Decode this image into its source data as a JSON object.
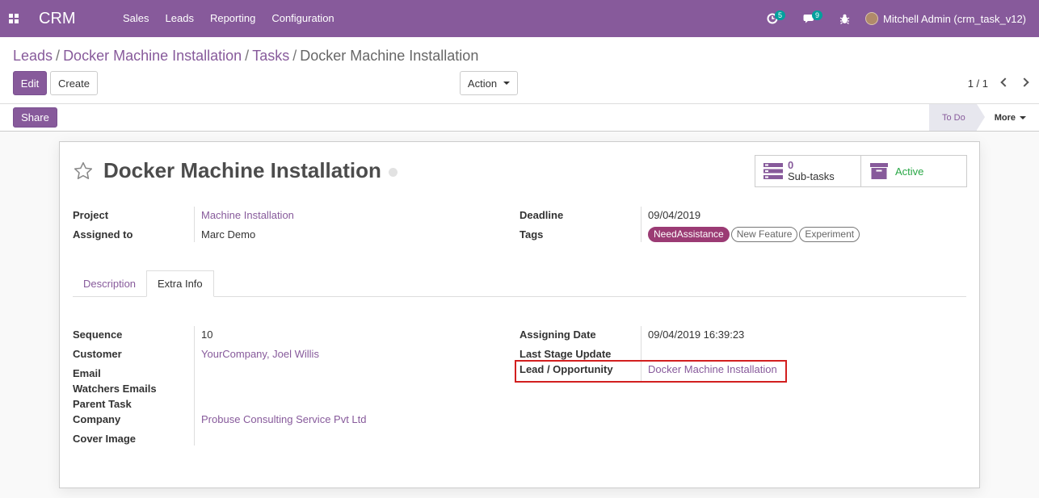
{
  "navbar": {
    "brand": "CRM",
    "menu": [
      "Sales",
      "Leads",
      "Reporting",
      "Configuration"
    ],
    "activity_count": "5",
    "messages_count": "9",
    "user": "Mitchell Admin (crm_task_v12)"
  },
  "breadcrumb": {
    "items": [
      "Leads",
      "Docker Machine Installation",
      "Tasks"
    ],
    "current": "Docker Machine Installation"
  },
  "buttons": {
    "edit": "Edit",
    "create": "Create",
    "action": "Action",
    "share": "Share"
  },
  "pager": "1 / 1",
  "statusbar": {
    "stage": "To Do",
    "more": "More"
  },
  "record": {
    "title": "Docker Machine Installation",
    "subtasks_count": "0",
    "subtasks_label": "Sub-tasks",
    "active_label": "Active"
  },
  "fields_top": {
    "project_label": "Project",
    "project_value": "Machine Installation",
    "assigned_label": "Assigned to",
    "assigned_value": "Marc Demo",
    "deadline_label": "Deadline",
    "deadline_value": "09/04/2019",
    "tags_label": "Tags",
    "tags": [
      "NeedAssistance",
      "New Feature",
      "Experiment"
    ]
  },
  "tabs": [
    "Description",
    "Extra Info"
  ],
  "extra_info": {
    "sequence_label": "Sequence",
    "sequence_value": "10",
    "customer_label": "Customer",
    "customer_value": "YourCompany, Joel Willis",
    "email_label": "Email",
    "watchers_label": "Watchers Emails",
    "parent_label": "Parent Task",
    "company_label": "Company",
    "company_value": "Probuse Consulting Service Pvt Ltd",
    "cover_label": "Cover Image",
    "assigning_label": "Assigning Date",
    "assigning_value": "09/04/2019 16:39:23",
    "last_stage_label": "Last Stage Update",
    "lead_label": "Lead / Opportunity",
    "lead_value": "Docker Machine Installation"
  },
  "colors": {
    "brand": "#875a9b",
    "highlight": "#d21f1f",
    "active": "#28a745"
  }
}
